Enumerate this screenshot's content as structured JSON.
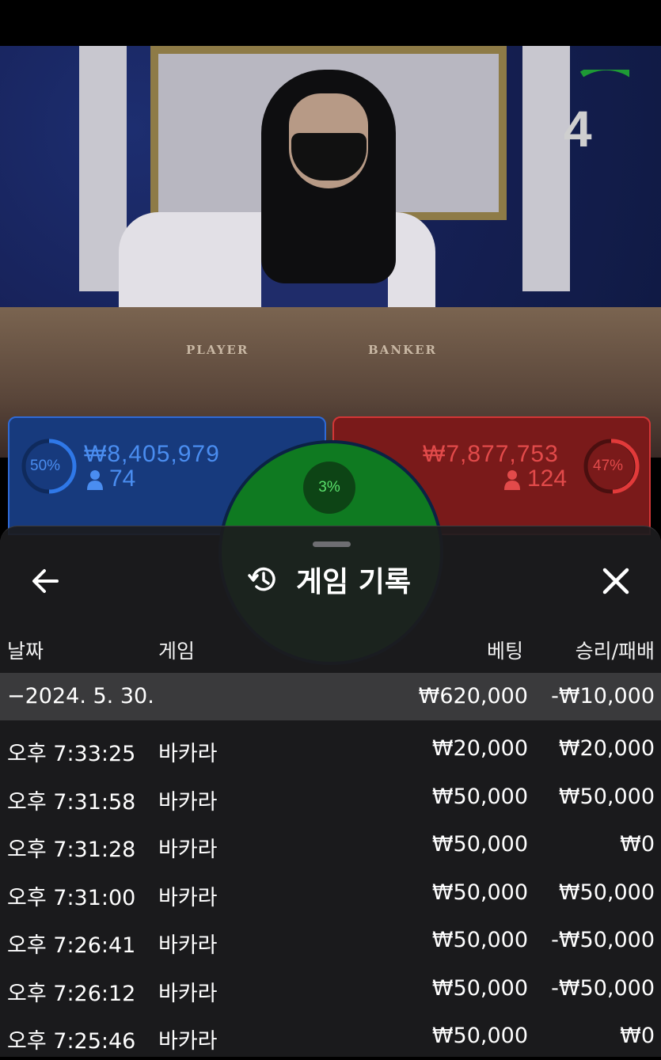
{
  "timer": {
    "value": "4"
  },
  "table_labels": {
    "player": "PLAYER",
    "banker": "BANKER"
  },
  "player": {
    "percent": "50%",
    "amount": "₩8,405,979",
    "count": "74",
    "color": "#2f6ad6"
  },
  "banker": {
    "percent": "47%",
    "amount": "₩7,877,753",
    "count": "124",
    "color": "#d33636"
  },
  "tie": {
    "percent": "3%",
    "color": "#12a12a"
  },
  "sheet": {
    "title": "게임 기록",
    "back_icon": "arrow-left-icon",
    "history_icon": "history-icon",
    "close_icon": "close-icon"
  },
  "table": {
    "headers": {
      "date": "날짜",
      "game": "게임",
      "bet": "베팅",
      "win_loss": "승리/패배"
    },
    "day": {
      "label": "−2024. 5. 30.",
      "bet": "₩620,000",
      "win_loss": "-₩10,000"
    },
    "rows": [
      {
        "time": "오후 7:33:25",
        "game": "바카라",
        "bet": "₩20,000",
        "win_loss": "₩20,000"
      },
      {
        "time": "오후 7:31:58",
        "game": "바카라",
        "bet": "₩50,000",
        "win_loss": "₩50,000"
      },
      {
        "time": "오후 7:31:28",
        "game": "바카라",
        "bet": "₩50,000",
        "win_loss": "₩0"
      },
      {
        "time": "오후 7:31:00",
        "game": "바카라",
        "bet": "₩50,000",
        "win_loss": "₩50,000"
      },
      {
        "time": "오후 7:26:41",
        "game": "바카라",
        "bet": "₩50,000",
        "win_loss": "-₩50,000"
      },
      {
        "time": "오후 7:26:12",
        "game": "바카라",
        "bet": "₩50,000",
        "win_loss": "-₩50,000"
      },
      {
        "time": "오후 7:25:46",
        "game": "바카라",
        "bet": "₩50,000",
        "win_loss": "₩0"
      }
    ]
  }
}
